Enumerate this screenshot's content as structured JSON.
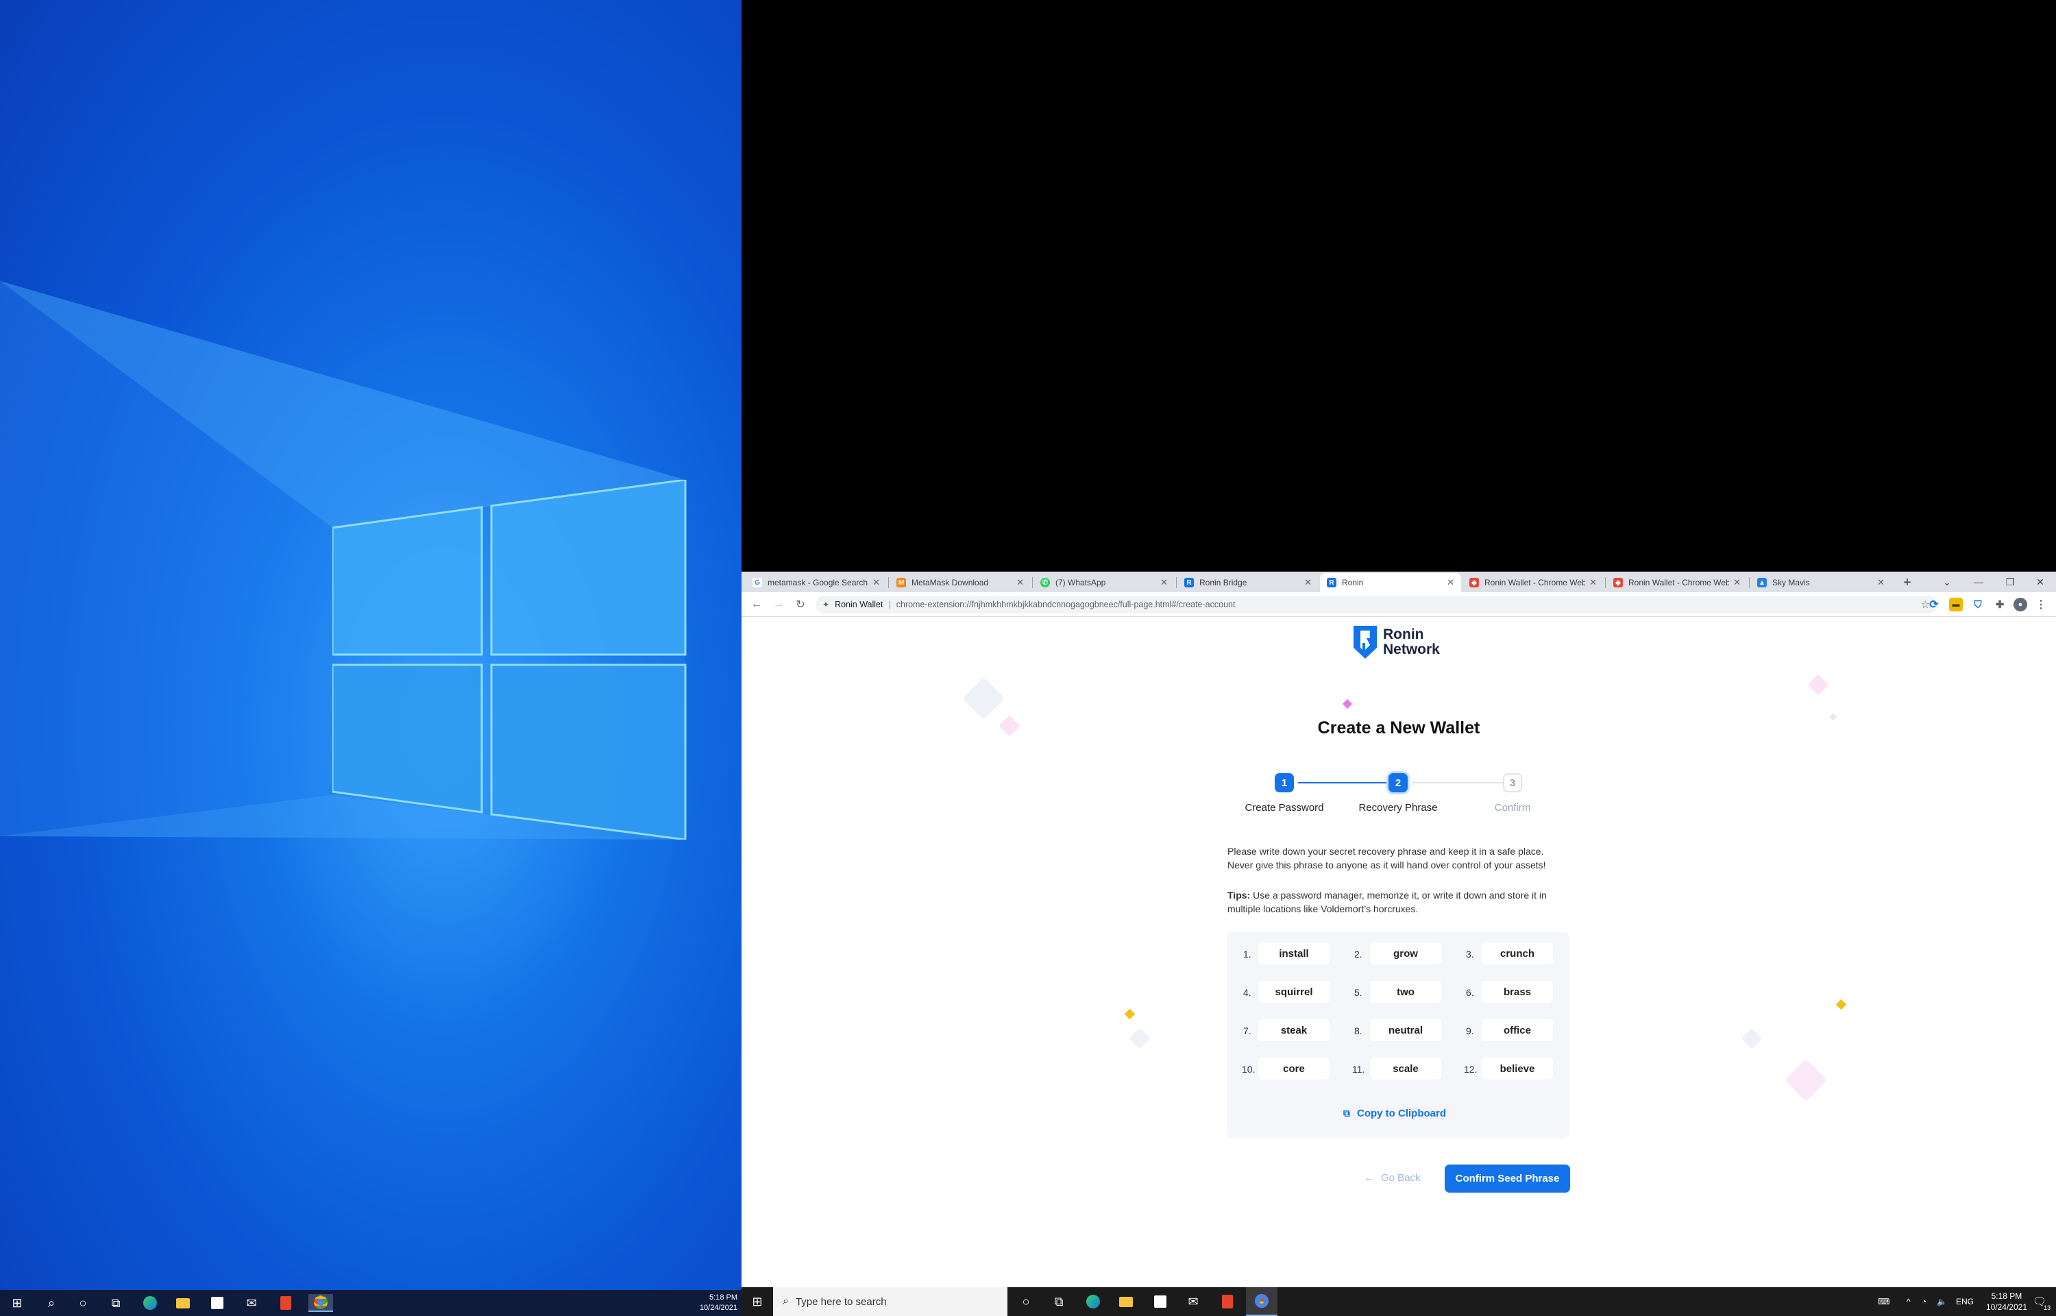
{
  "desktop_left": {
    "clock_time": "5:18 PM",
    "clock_date": "10/24/2021",
    "taskbar_icons": [
      "start-icon",
      "search-icon",
      "cortana-icon",
      "task-view-icon",
      "edge-icon",
      "file-explorer-icon",
      "store-icon",
      "mail-icon",
      "office-icon",
      "chrome-icon"
    ]
  },
  "browser": {
    "tabs": [
      {
        "title": "metamask - Google Search",
        "favicon": "google-icon"
      },
      {
        "title": "MetaMask Download",
        "favicon": "metamask-icon"
      },
      {
        "title": "(7) WhatsApp",
        "favicon": "whatsapp-icon"
      },
      {
        "title": "Ronin Bridge",
        "favicon": "ronin-icon"
      },
      {
        "title": "Ronin",
        "favicon": "ronin-icon",
        "active": true
      },
      {
        "title": "Ronin Wallet - Chrome Web",
        "favicon": "chrome-store-icon"
      },
      {
        "title": "Ronin Wallet - Chrome Web",
        "favicon": "chrome-store-icon"
      },
      {
        "title": "Sky Mavis",
        "favicon": "sky-mavis-icon"
      }
    ],
    "new_tab_label": "+",
    "omnibox": {
      "site_name": "Ronin Wallet",
      "url": "chrome-extension://fnjhmkhhmkbjkkabndcnnogagogbneec/full-page.html#/create-account"
    }
  },
  "page": {
    "logo_line1": "Ronin",
    "logo_line2": "Network",
    "title": "Create a New Wallet",
    "steps": [
      {
        "number": "1",
        "label": "Create Password",
        "state": "done"
      },
      {
        "number": "2",
        "label": "Recovery Phrase",
        "state": "active"
      },
      {
        "number": "3",
        "label": "Confirm",
        "state": "pending"
      }
    ],
    "instruction_line1": "Please write down your secret recovery phrase and keep it in a safe place.",
    "instruction_line2": "Never give this phrase to anyone as it will hand over control of your assets!",
    "tips_label": "Tips:",
    "tips_line1": " Use a password manager, memorize it, or write it down and store it in",
    "tips_line2": "multiple locations like Voldemort’s horcruxes.",
    "words": [
      {
        "num": "1.",
        "word": "install"
      },
      {
        "num": "2.",
        "word": "grow"
      },
      {
        "num": "3.",
        "word": "crunch"
      },
      {
        "num": "4.",
        "word": "squirrel"
      },
      {
        "num": "5.",
        "word": "two"
      },
      {
        "num": "6.",
        "word": "brass"
      },
      {
        "num": "7.",
        "word": "steak"
      },
      {
        "num": "8.",
        "word": "neutral"
      },
      {
        "num": "9.",
        "word": "office"
      },
      {
        "num": "10.",
        "word": "core"
      },
      {
        "num": "11.",
        "word": "scale"
      },
      {
        "num": "12.",
        "word": "believe"
      }
    ],
    "copy_label": "Copy to Clipboard",
    "go_back_label": "Go Back",
    "confirm_label": "Confirm Seed Phrase",
    "accent_color": "#1273ea"
  },
  "taskbar_right": {
    "search_placeholder": "Type here to search",
    "language": "ENG",
    "clock_time": "5:18 PM",
    "clock_date": "10/24/2021",
    "notification_count": "13"
  }
}
